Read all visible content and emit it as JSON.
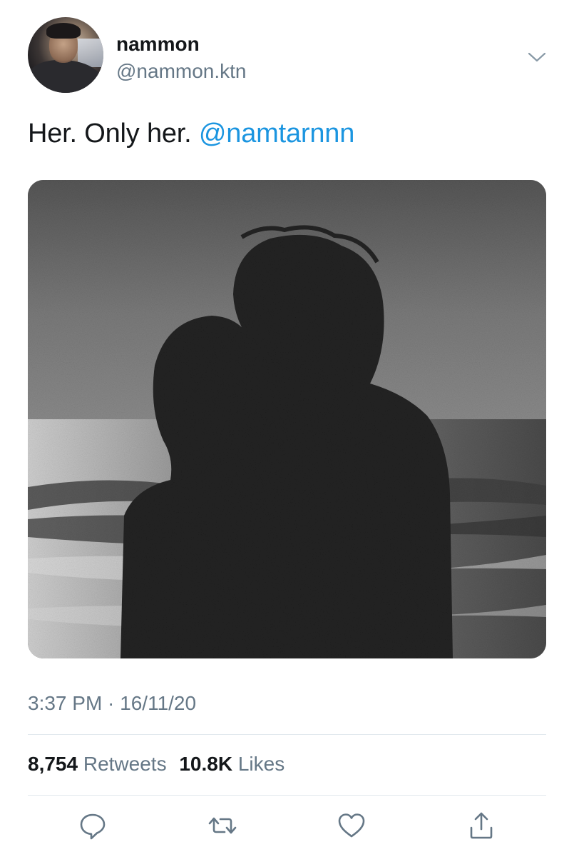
{
  "tweet": {
    "user": {
      "display_name": "nammon",
      "handle": "@nammon.ktn"
    },
    "text_prefix": "Her. Only her. ",
    "mention": "@namtarnnn",
    "media": {
      "description_icon": "photo"
    },
    "timestamp": "3:37 PM · 16/11/20",
    "stats": {
      "retweets_count": "8,754",
      "retweets_label": "Retweets",
      "likes_count": "10.8K",
      "likes_label": "Likes"
    },
    "actions": {
      "reply_icon": "speech-bubble-icon",
      "retweet_icon": "retweet-icon",
      "like_icon": "heart-icon",
      "share_icon": "share-icon"
    }
  },
  "colors": {
    "text": "#14171a",
    "secondary": "#657786",
    "link": "#1b95e0",
    "divider": "#e1e8ed"
  }
}
